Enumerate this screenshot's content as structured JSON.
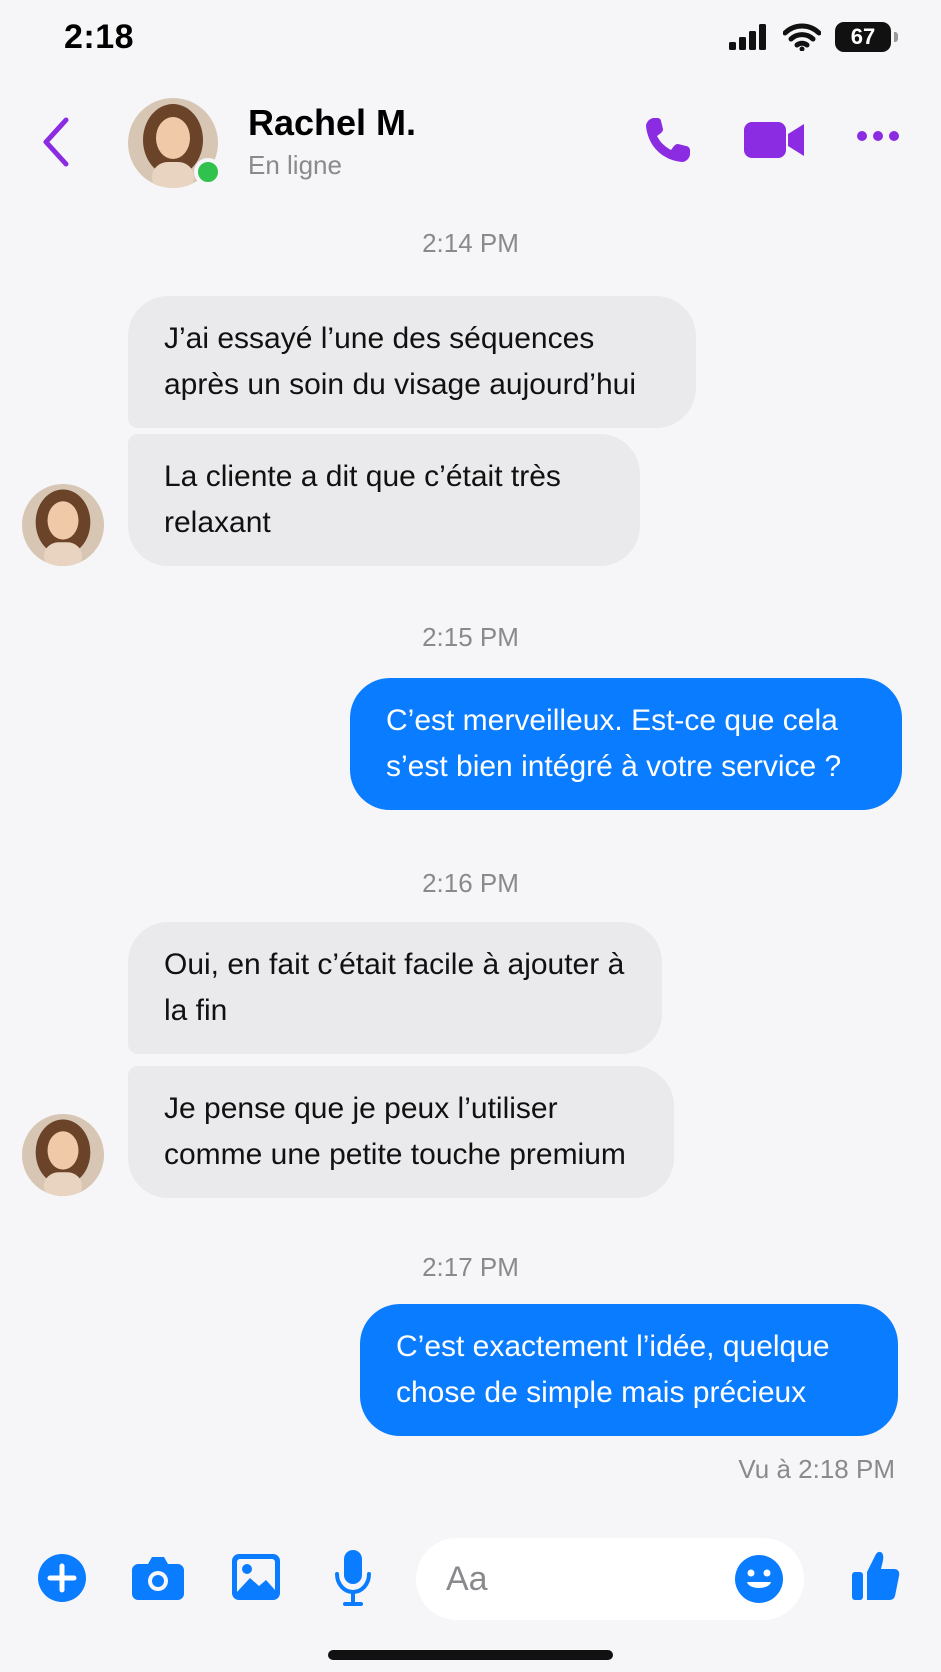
{
  "status_bar": {
    "time": "2:18",
    "battery": "67"
  },
  "header": {
    "back_icon": "chevron-left-icon",
    "name": "Rachel M.",
    "status": "En ligne",
    "accent": "#8b2be2"
  },
  "conversation": [
    {
      "time": "2:14 PM"
    },
    {
      "incoming": [
        "J’ai essayé l’une des séquences après un soin du visage aujourd’hui",
        "La cliente a dit que c’était très relaxant"
      ]
    },
    {
      "time": "2:15 PM"
    },
    {
      "outgoing": "C’est merveilleux. Est-ce que cela s’est bien intégré à votre service ?"
    },
    {
      "time": "2:16 PM"
    },
    {
      "incoming": [
        "Oui,  en fait c’était facile à ajouter à la fin",
        "Je pense que je peux l’utiliser comme une petite touche premium"
      ]
    },
    {
      "time": "2:17 PM"
    },
    {
      "outgoing": "C’est exactement l’idée, quelque chose de simple mais précieux"
    }
  ],
  "seen_receipt": "Vu à 2:18 PM",
  "composer": {
    "placeholder": "Aa",
    "icons": [
      "plus-icon",
      "camera-icon",
      "image-icon",
      "microphone-icon",
      "emoji-icon",
      "thumbs-up-icon"
    ],
    "accent": "#0a7cff"
  },
  "colors": {
    "incoming_bubble": "#eaeaec",
    "outgoing_bubble": "#0a7cff",
    "online": "#31c24d"
  }
}
